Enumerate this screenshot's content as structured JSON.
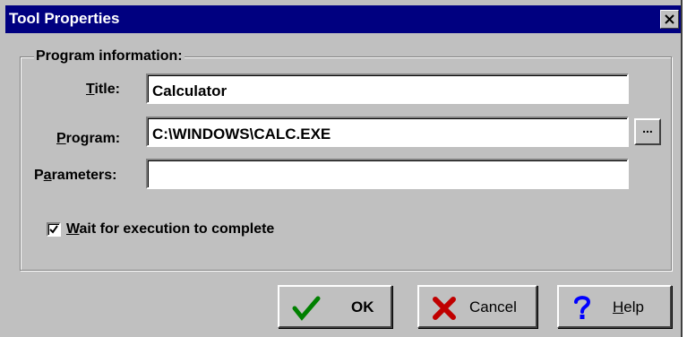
{
  "window": {
    "title": "Tool Properties"
  },
  "group": {
    "label": "Program information:"
  },
  "fields": {
    "title": {
      "label_pre": "",
      "label_ul": "T",
      "label_post": "itle:",
      "value": "Calculator"
    },
    "program": {
      "label_pre": "",
      "label_ul": "P",
      "label_post": "rogram:",
      "value": "C:\\WINDOWS\\CALC.EXE"
    },
    "parameters": {
      "label_pre": "P",
      "label_ul": "a",
      "label_post": "rameters:",
      "value": ""
    }
  },
  "browse": {
    "label": "..."
  },
  "checkbox": {
    "label_ul": "W",
    "label_post": "ait for execution to complete",
    "checked": true
  },
  "buttons": {
    "ok": {
      "label": "OK",
      "icon": "checkmark-icon"
    },
    "cancel": {
      "label": "Cancel",
      "icon": "x-icon"
    },
    "help": {
      "label_ul": "H",
      "label_post": "elp",
      "icon": "question-mark-icon"
    }
  },
  "colors": {
    "titlebar": "#000080",
    "face": "#c0c0c0",
    "ok_icon": "#008000",
    "cancel_icon": "#c00000",
    "help_icon": "#0000ff"
  }
}
